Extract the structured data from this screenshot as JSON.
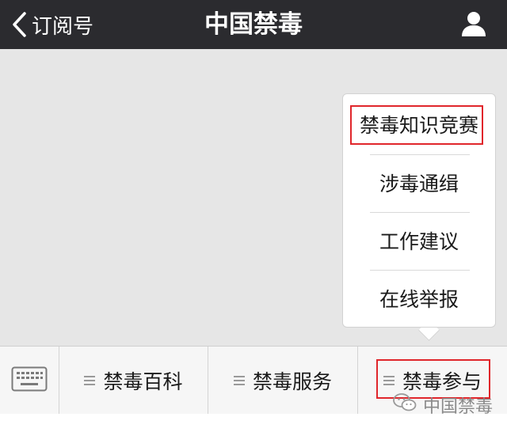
{
  "navbar": {
    "back_label": "订阅号",
    "title": "中国禁毒"
  },
  "popup": {
    "items": [
      {
        "label": "禁毒知识竞赛",
        "highlighted": true
      },
      {
        "label": "涉毒通缉",
        "highlighted": false
      },
      {
        "label": "工作建议",
        "highlighted": false
      },
      {
        "label": "在线举报",
        "highlighted": false
      }
    ]
  },
  "menubar": {
    "items": [
      {
        "label": "禁毒百科",
        "highlighted": false
      },
      {
        "label": "禁毒服务",
        "highlighted": false
      },
      {
        "label": "禁毒参与",
        "highlighted": true
      }
    ]
  },
  "watermark": {
    "text": "中国禁毒"
  },
  "colors": {
    "navbar_bg": "#2b2b2f",
    "content_bg": "#e6e6e6",
    "highlight_border": "#e0262b"
  },
  "icons": {
    "back": "chevron-left-icon",
    "profile": "person-icon",
    "keyboard": "keyboard-icon",
    "menu": "menu-lines-icon",
    "watermark": "wechat-icon"
  }
}
